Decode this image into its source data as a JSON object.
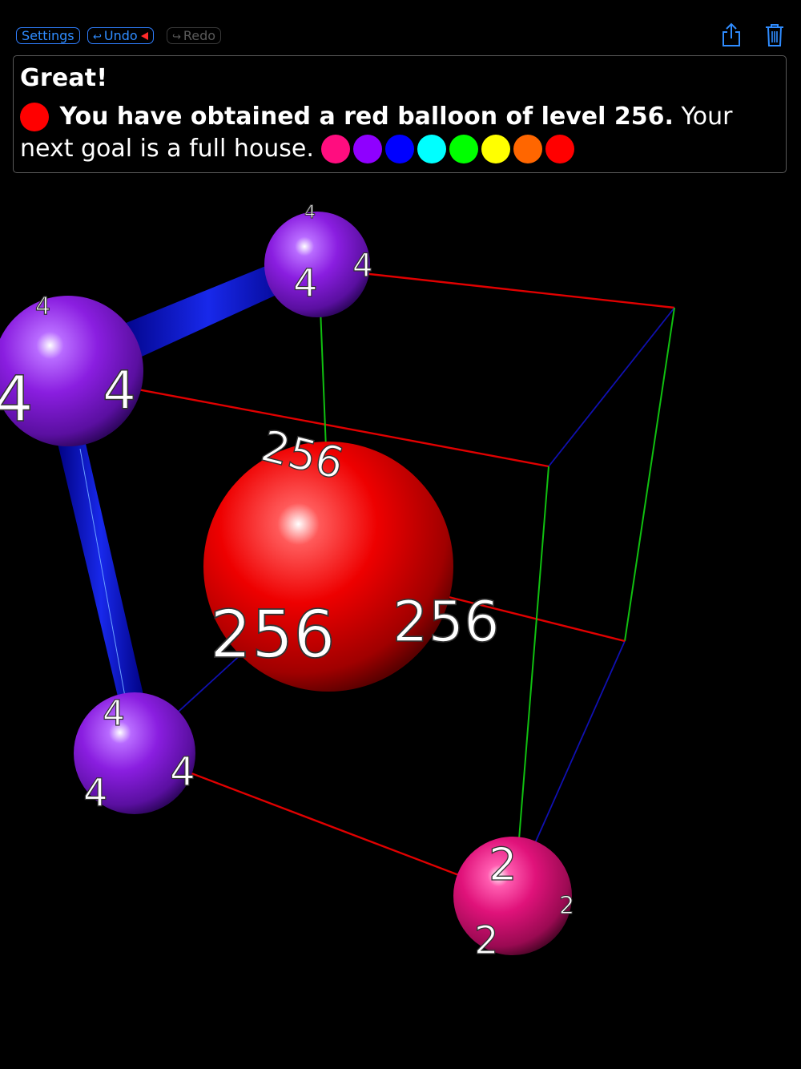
{
  "toolbar": {
    "settings_label": "Settings",
    "undo_label": "Undo",
    "redo_label": "Redo",
    "share_icon": "share-icon",
    "trash_icon": "trash-icon",
    "accent": "#2f8cff"
  },
  "message": {
    "title": "Great!",
    "bold_text": "You have obtained a red balloon of level 256.",
    "rest_text": "Your next goal is a full house.",
    "current_balloon_color": "#ff0000",
    "goal_colors": [
      "#ff0d7f",
      "#8f00ff",
      "#0000ff",
      "#00ffff",
      "#00ff00",
      "#ffff00",
      "#ff6600",
      "#ff0000"
    ]
  },
  "balloons": [
    {
      "level": "256",
      "color": "#ee0000"
    },
    {
      "level": "4",
      "color": "#8a1ee0"
    },
    {
      "level": "4",
      "color": "#8a1ee0"
    },
    {
      "level": "4",
      "color": "#8a1ee0"
    },
    {
      "level": "2",
      "color": "#e0127a"
    }
  ]
}
